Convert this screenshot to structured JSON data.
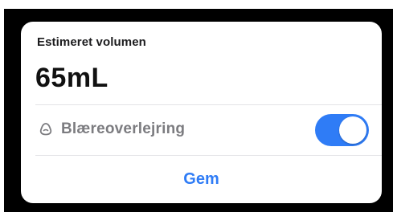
{
  "card": {
    "label": "Estimeret volumen",
    "value": "65mL",
    "overlay": {
      "icon": "bladder-icon",
      "label": "Blæreoverlejring",
      "enabled": true
    },
    "save_label": "Gem"
  },
  "colors": {
    "accent": "#2f7cf6",
    "backdrop": "#000000",
    "card": "#ffffff",
    "secondary_text": "#7c7c80"
  }
}
